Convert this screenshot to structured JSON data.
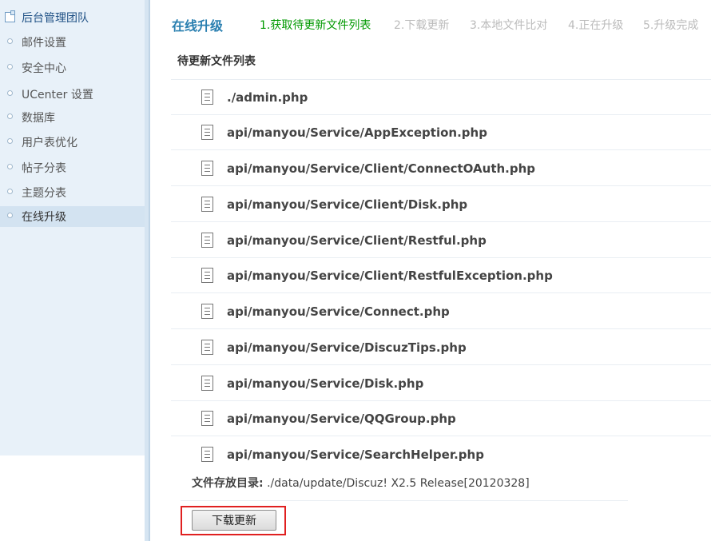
{
  "sidebar": {
    "group_title": "后台管理团队",
    "items": [
      {
        "label": "邮件设置",
        "active": false
      },
      {
        "label": "安全中心",
        "active": false
      },
      {
        "label": "UCenter 设置",
        "active": false
      },
      {
        "label": "数据库",
        "active": false
      },
      {
        "label": "用户表优化",
        "active": false
      },
      {
        "label": "帖子分表",
        "active": false
      },
      {
        "label": "主题分表",
        "active": false
      },
      {
        "label": "在线升级",
        "active": true
      }
    ]
  },
  "main": {
    "title": "在线升级",
    "steps": [
      {
        "label": "1.获取待更新文件列表",
        "current": true
      },
      {
        "label": "2.下载更新",
        "current": false
      },
      {
        "label": "3.本地文件比对",
        "current": false
      },
      {
        "label": "4.正在升级",
        "current": false
      },
      {
        "label": "5.升级完成",
        "current": false
      }
    ],
    "section_title": "待更新文件列表",
    "files": [
      "./admin.php",
      "api/manyou/Service/AppException.php",
      "api/manyou/Service/Client/ConnectOAuth.php",
      "api/manyou/Service/Client/Disk.php",
      "api/manyou/Service/Client/Restful.php",
      "api/manyou/Service/Client/RestfulException.php",
      "api/manyou/Service/Connect.php",
      "api/manyou/Service/DiscuzTips.php",
      "api/manyou/Service/Disk.php",
      "api/manyou/Service/QQGroup.php",
      "api/manyou/Service/SearchHelper.php"
    ],
    "storage_label": "文件存放目录:",
    "storage_path": "./data/update/Discuz! X2.5 Release[20120328]",
    "download_button": "下载更新"
  },
  "icons": {
    "group": "folder-window-icon",
    "nav_bullet": "circle-bullet-icon",
    "file": "document-icon"
  },
  "colors": {
    "sidebar_bg": "#e8f1f9",
    "title": "#2a7fb0",
    "current_step": "#009900",
    "inactive_step": "#bbbbbb",
    "highlight_frame": "#e02020"
  }
}
